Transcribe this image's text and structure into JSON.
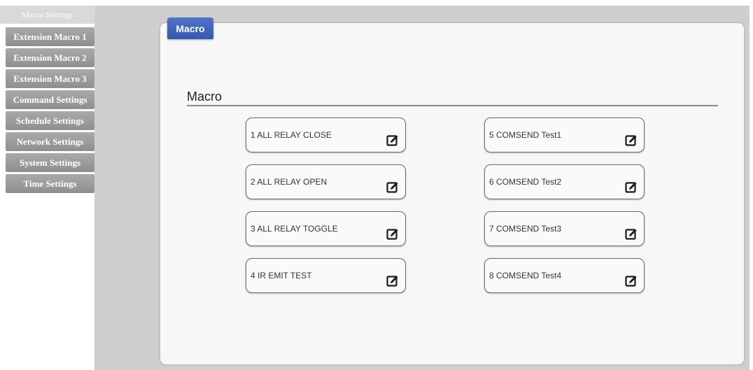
{
  "sidebar": {
    "items": [
      {
        "label": "Macro Settings",
        "active": true
      },
      {
        "label": "Extension Macro 1"
      },
      {
        "label": "Extension Macro 2"
      },
      {
        "label": "Extension Macro 3"
      },
      {
        "label": "Command Settings"
      },
      {
        "label": "Schedule Settings"
      },
      {
        "label": "Network Settings"
      },
      {
        "label": "System Settings"
      },
      {
        "label": "Time Settings"
      }
    ]
  },
  "panel": {
    "tab_label": "Macro",
    "section_title": "Macro"
  },
  "macros": [
    {
      "label": "1 ALL RELAY CLOSE"
    },
    {
      "label": "2 ALL RELAY OPEN"
    },
    {
      "label": "3 ALL RELAY TOGGLE"
    },
    {
      "label": "4 IR EMIT TEST"
    },
    {
      "label": "5 COMSEND Test1"
    },
    {
      "label": "6 COMSEND Test2"
    },
    {
      "label": "7 COMSEND Test3"
    },
    {
      "label": "8 COMSEND Test4"
    }
  ],
  "icons": {
    "edit": "edit-icon"
  },
  "colors": {
    "tab_blue": "#3f64bb",
    "nav_gray": "#9c9c9c",
    "nav_active": "#d9d9d9",
    "content_bg": "#cfcfcf"
  }
}
